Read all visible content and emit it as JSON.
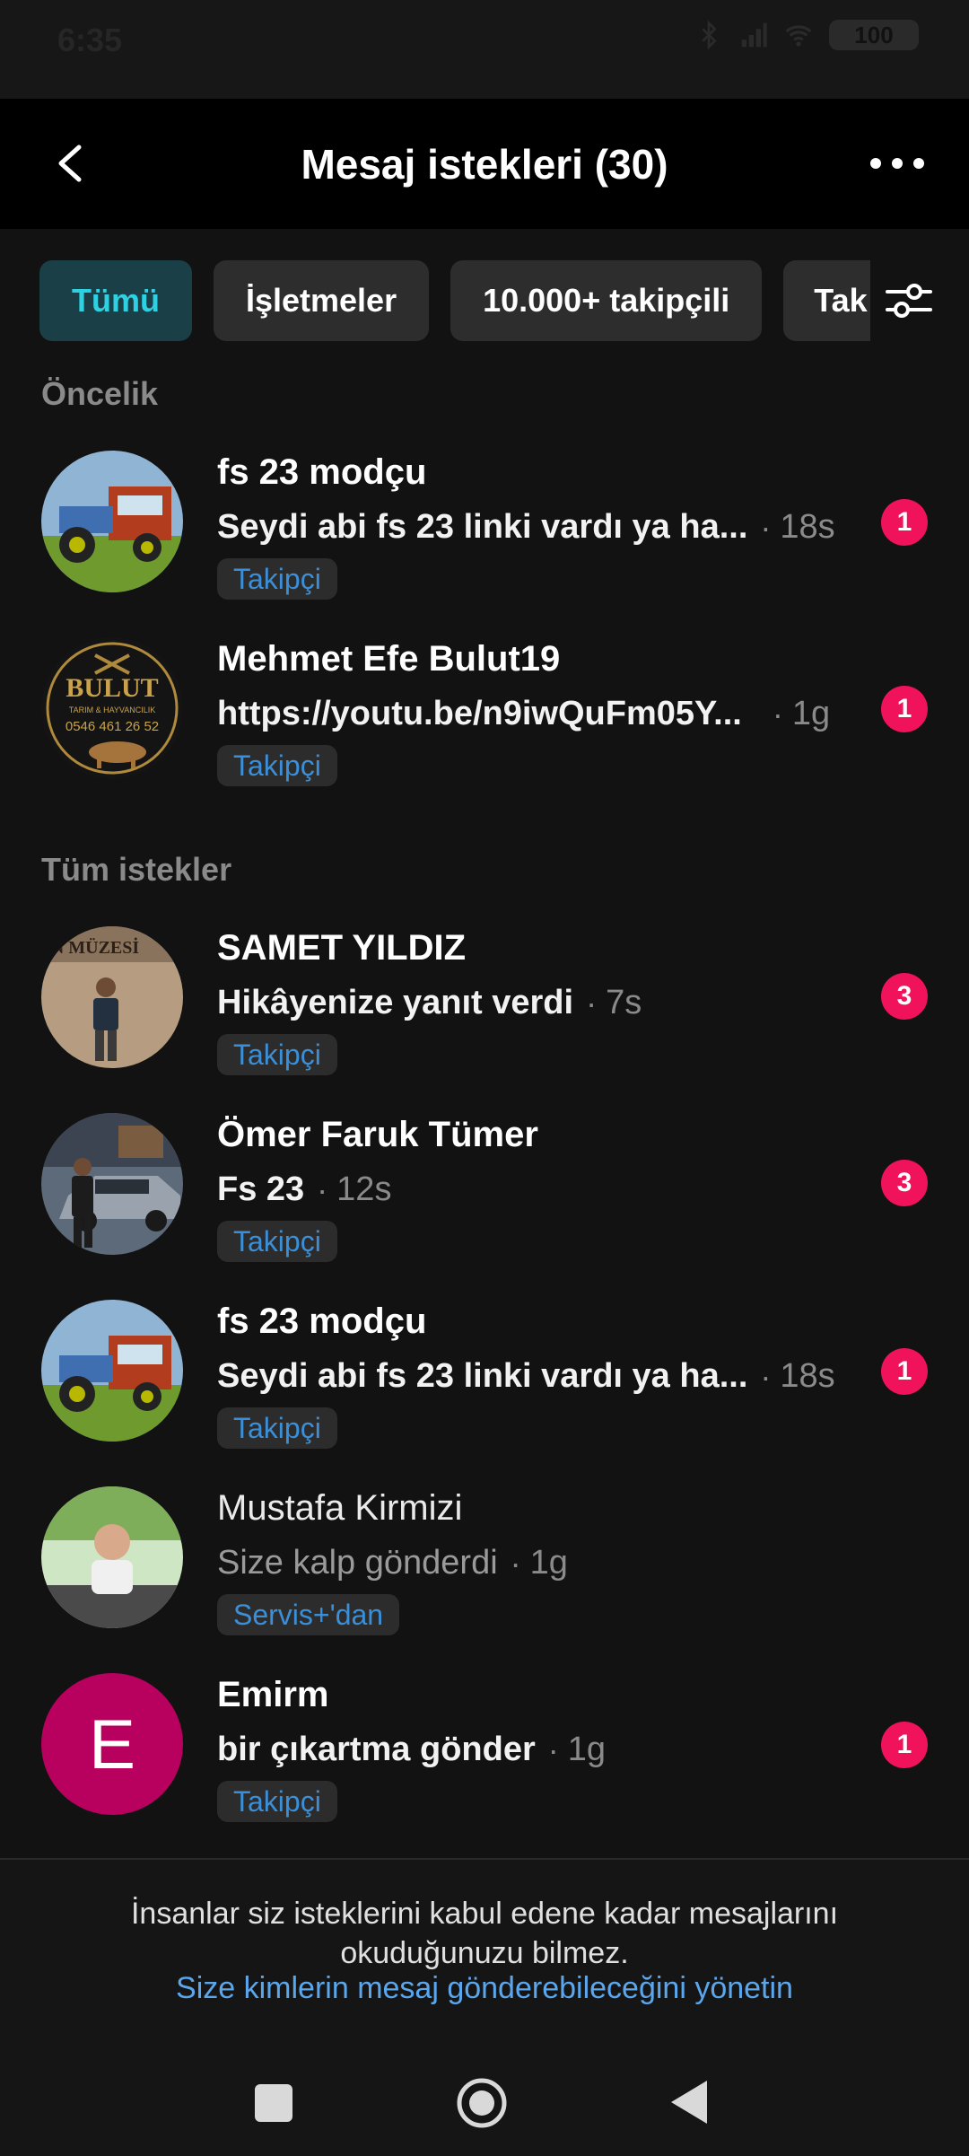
{
  "status_bar": {
    "time": "6:35",
    "battery": "100"
  },
  "header": {
    "title": "Mesaj istekleri (30)"
  },
  "filters": [
    {
      "label": "Tümü",
      "active": true
    },
    {
      "label": "İşletmeler",
      "active": false
    },
    {
      "label": "10.000+ takipçili",
      "active": false
    },
    {
      "label": "Tak",
      "active": false
    }
  ],
  "sections": {
    "priority": "Öncelik",
    "all": "Tüm istekler"
  },
  "priority_requests": [
    {
      "name": "fs 23 modçu",
      "message": "Seydi abi fs 23 linki vardı ya ha...",
      "time": "18s",
      "tag": "Takipçi",
      "badge": "1",
      "avatar": "tractor"
    },
    {
      "name": "Mehmet Efe Bulut19",
      "message": "https://youtu.be/n9iwQuFm05Y...",
      "time": "1g",
      "tag": "Takipçi",
      "badge": "1",
      "avatar": "bulut"
    }
  ],
  "all_requests": [
    {
      "name": "SAMET YILDIZ",
      "message": "Hikâyenize yanıt verdi",
      "time": "7s",
      "tag": "Takipçi",
      "badge": "3",
      "avatar": "person-museum"
    },
    {
      "name": "Ömer Faruk Tümer",
      "message": "Fs 23",
      "time": "12s",
      "tag": "Takipçi",
      "badge": "3",
      "avatar": "person-car"
    },
    {
      "name": "fs 23 modçu",
      "message": "Seydi abi fs 23 linki vardı ya ha...",
      "time": "18s",
      "tag": "Takipçi",
      "badge": "1",
      "avatar": "tractor"
    },
    {
      "name": "Mustafa Kirmizi",
      "message": "Size kalp gönderdi",
      "time": "1g",
      "tag": "Servis+'dan",
      "badge": "",
      "avatar": "person-outdoor"
    },
    {
      "name": "Emirm",
      "message": "bir çıkartma gönder",
      "time": "1g",
      "tag": "Takipçi",
      "badge": "1",
      "avatar": "E"
    }
  ],
  "footer": {
    "note": "İnsanlar siz isteklerini kabul edene kadar mesajlarını okuduğunuzu bilmez.",
    "link": "Size kimlerin mesaj gönderebileceğini yönetin"
  },
  "colors": {
    "accent_chip_text": "#2ed1e1",
    "badge": "#f0135b",
    "tag_text": "#3b8fd8",
    "link": "#5aa7ee",
    "emirm_avatar": "#b8005e"
  }
}
